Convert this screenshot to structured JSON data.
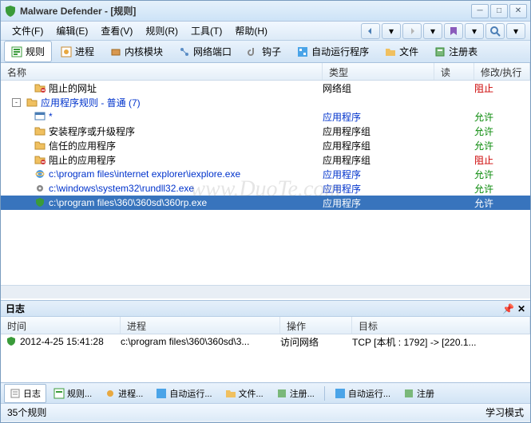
{
  "window": {
    "title": "Malware Defender - [规则]"
  },
  "menu": {
    "file": "文件(F)",
    "edit": "编辑(E)",
    "view": "查看(V)",
    "rule": "规则(R)",
    "tool": "工具(T)",
    "help": "帮助(H)"
  },
  "tabs": {
    "rules": "规则",
    "process": "进程",
    "kernel": "内核模块",
    "netport": "网络端口",
    "hook": "钩子",
    "autorun": "自动运行程序",
    "files": "文件",
    "registry": "注册表"
  },
  "columns": {
    "name": "名称",
    "type": "类型",
    "read": "读",
    "action": "修改/执行"
  },
  "rules_list": [
    {
      "indent": 1,
      "icon": "folder-blocked",
      "name": "阻止的网址",
      "type": "网络组",
      "action": "阻止",
      "action_class": "red",
      "name_class": ""
    },
    {
      "indent": 0,
      "expander": "-",
      "icon": "folder-app",
      "name": "应用程序规则 - 普通 (7)",
      "type": "",
      "action": "",
      "name_class": "blue"
    },
    {
      "indent": 1,
      "icon": "app-all",
      "name": "*",
      "type": "应用程序",
      "action": "允许",
      "action_class": "green",
      "name_class": "blue"
    },
    {
      "indent": 1,
      "icon": "folder",
      "name": "安装程序或升级程序",
      "type": "应用程序组",
      "action": "允许",
      "action_class": "green",
      "name_class": ""
    },
    {
      "indent": 1,
      "icon": "folder",
      "name": "信任的应用程序",
      "type": "应用程序组",
      "action": "允许",
      "action_class": "green",
      "name_class": ""
    },
    {
      "indent": 1,
      "icon": "folder-blocked",
      "name": "阻止的应用程序",
      "type": "应用程序组",
      "action": "阻止",
      "action_class": "red",
      "name_class": ""
    },
    {
      "indent": 1,
      "icon": "ie",
      "name": "c:\\program files\\internet explorer\\iexplore.exe",
      "type": "应用程序",
      "action": "允许",
      "action_class": "green",
      "name_class": "blue"
    },
    {
      "indent": 1,
      "icon": "gear",
      "name": "c:\\windows\\system32\\rundll32.exe",
      "type": "应用程序",
      "action": "允许",
      "action_class": "green",
      "name_class": "blue"
    },
    {
      "indent": 1,
      "icon": "shield",
      "name": "c:\\program files\\360\\360sd\\360rp.exe",
      "type": "应用程序",
      "action": "允许",
      "action_class": "green",
      "name_class": "blue",
      "selected": true
    }
  ],
  "log": {
    "title": "日志",
    "cols": {
      "time": "时间",
      "process": "进程",
      "operation": "操作",
      "target": "目标"
    },
    "rows": [
      {
        "time": "2012-4-25 15:41:28",
        "process": "c:\\program files\\360\\360sd\\3...",
        "operation": "访问网络",
        "target": "TCP [本机 : 1792] -> [220.1..."
      }
    ]
  },
  "bottom_tabs": {
    "log": "日志",
    "rules": "规则...",
    "process": "进程...",
    "autorun": "自动运行...",
    "files": "文件...",
    "registry": "注册...",
    "autorun2": "自动运行...",
    "register": "注册"
  },
  "status": {
    "left": "35个规则",
    "right": "学习模式"
  },
  "watermark": "www.DuoTe.com"
}
